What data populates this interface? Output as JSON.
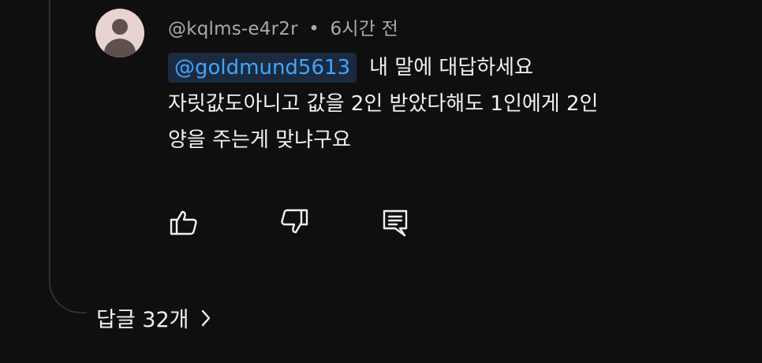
{
  "comment": {
    "author": "@kqlms-e4r2r",
    "separator": "•",
    "time": "6시간 전",
    "mention": "@goldmund5613",
    "text_line1": "내 말에 대답하세요",
    "text_line2": "자릿값도아니고 값을 2인 받았다해도 1인에게 2인",
    "text_line3": "양을 주는게 맞냐구요"
  },
  "actions": {
    "like_icon": "thumbs-up-icon",
    "dislike_icon": "thumbs-down-icon",
    "reply_icon": "comment-icon"
  },
  "replies": {
    "label": "답글 32개",
    "icon": "chevron-right-icon"
  },
  "colors": {
    "background": "#0f0f0f",
    "text": "#f1f1f1",
    "muted": "#aaaaaa",
    "mention": "#3ea6ff",
    "mention_bg": "#1c2a3f"
  }
}
